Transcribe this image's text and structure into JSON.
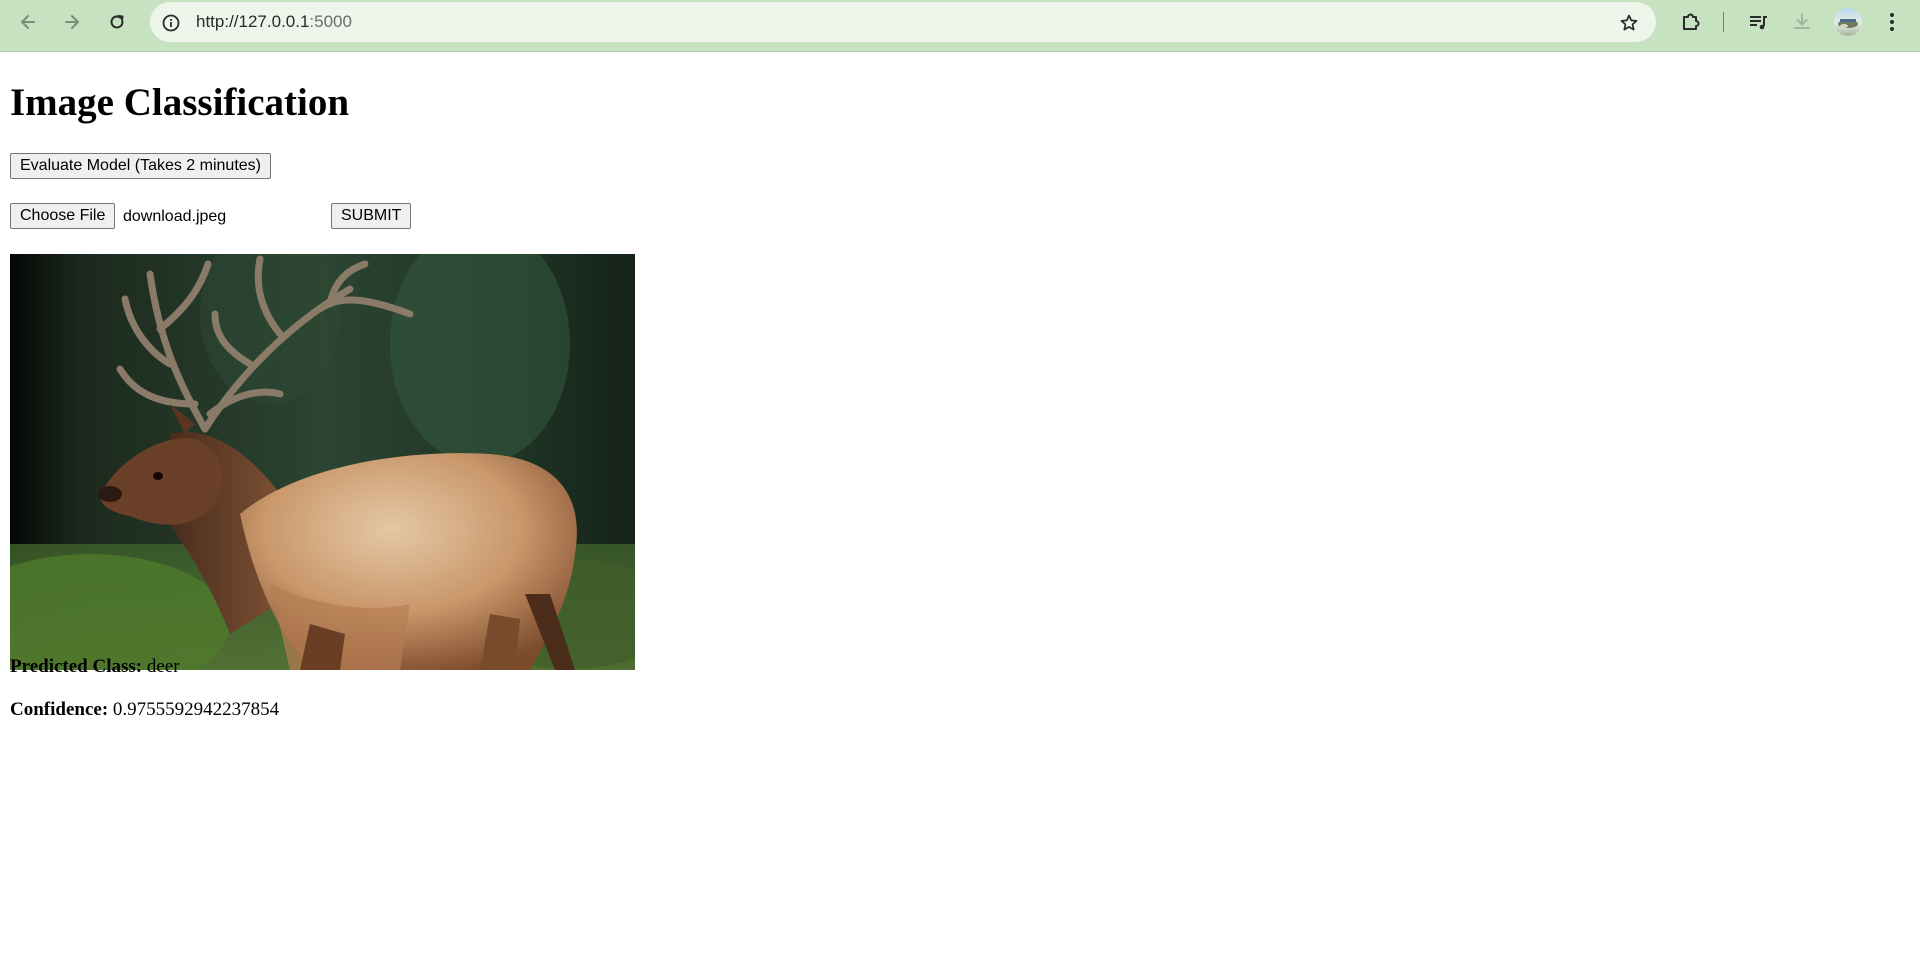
{
  "browser": {
    "url_host": "http://127.0.0.1",
    "url_port": ":5000"
  },
  "icons": {
    "back": "arrow-left-icon",
    "forward": "arrow-right-icon",
    "reload": "reload-icon",
    "site_info": "info-icon",
    "bookmark": "star-icon",
    "extensions": "puzzle-icon",
    "media": "playlist-music-icon",
    "downloads": "download-icon",
    "profile": "avatar",
    "menu": "kebab-menu-icon"
  },
  "page": {
    "title": "Image Classification",
    "evaluate_button": "Evaluate Model (Takes 2 minutes)",
    "choose_file_button": "Choose File",
    "selected_file": "download.jpeg",
    "submit_button": "SUBMIT",
    "image_subject": "elk / deer walking, forest background",
    "predicted_label": "Predicted Class:",
    "predicted_value": "deer",
    "confidence_label": "Confidence:",
    "confidence_value": "0.9755592942237854"
  },
  "colors": {
    "toolbar_bg": "#c6e2c1",
    "omnibox_bg": "#eef6ec",
    "button_bg": "#efefef"
  }
}
